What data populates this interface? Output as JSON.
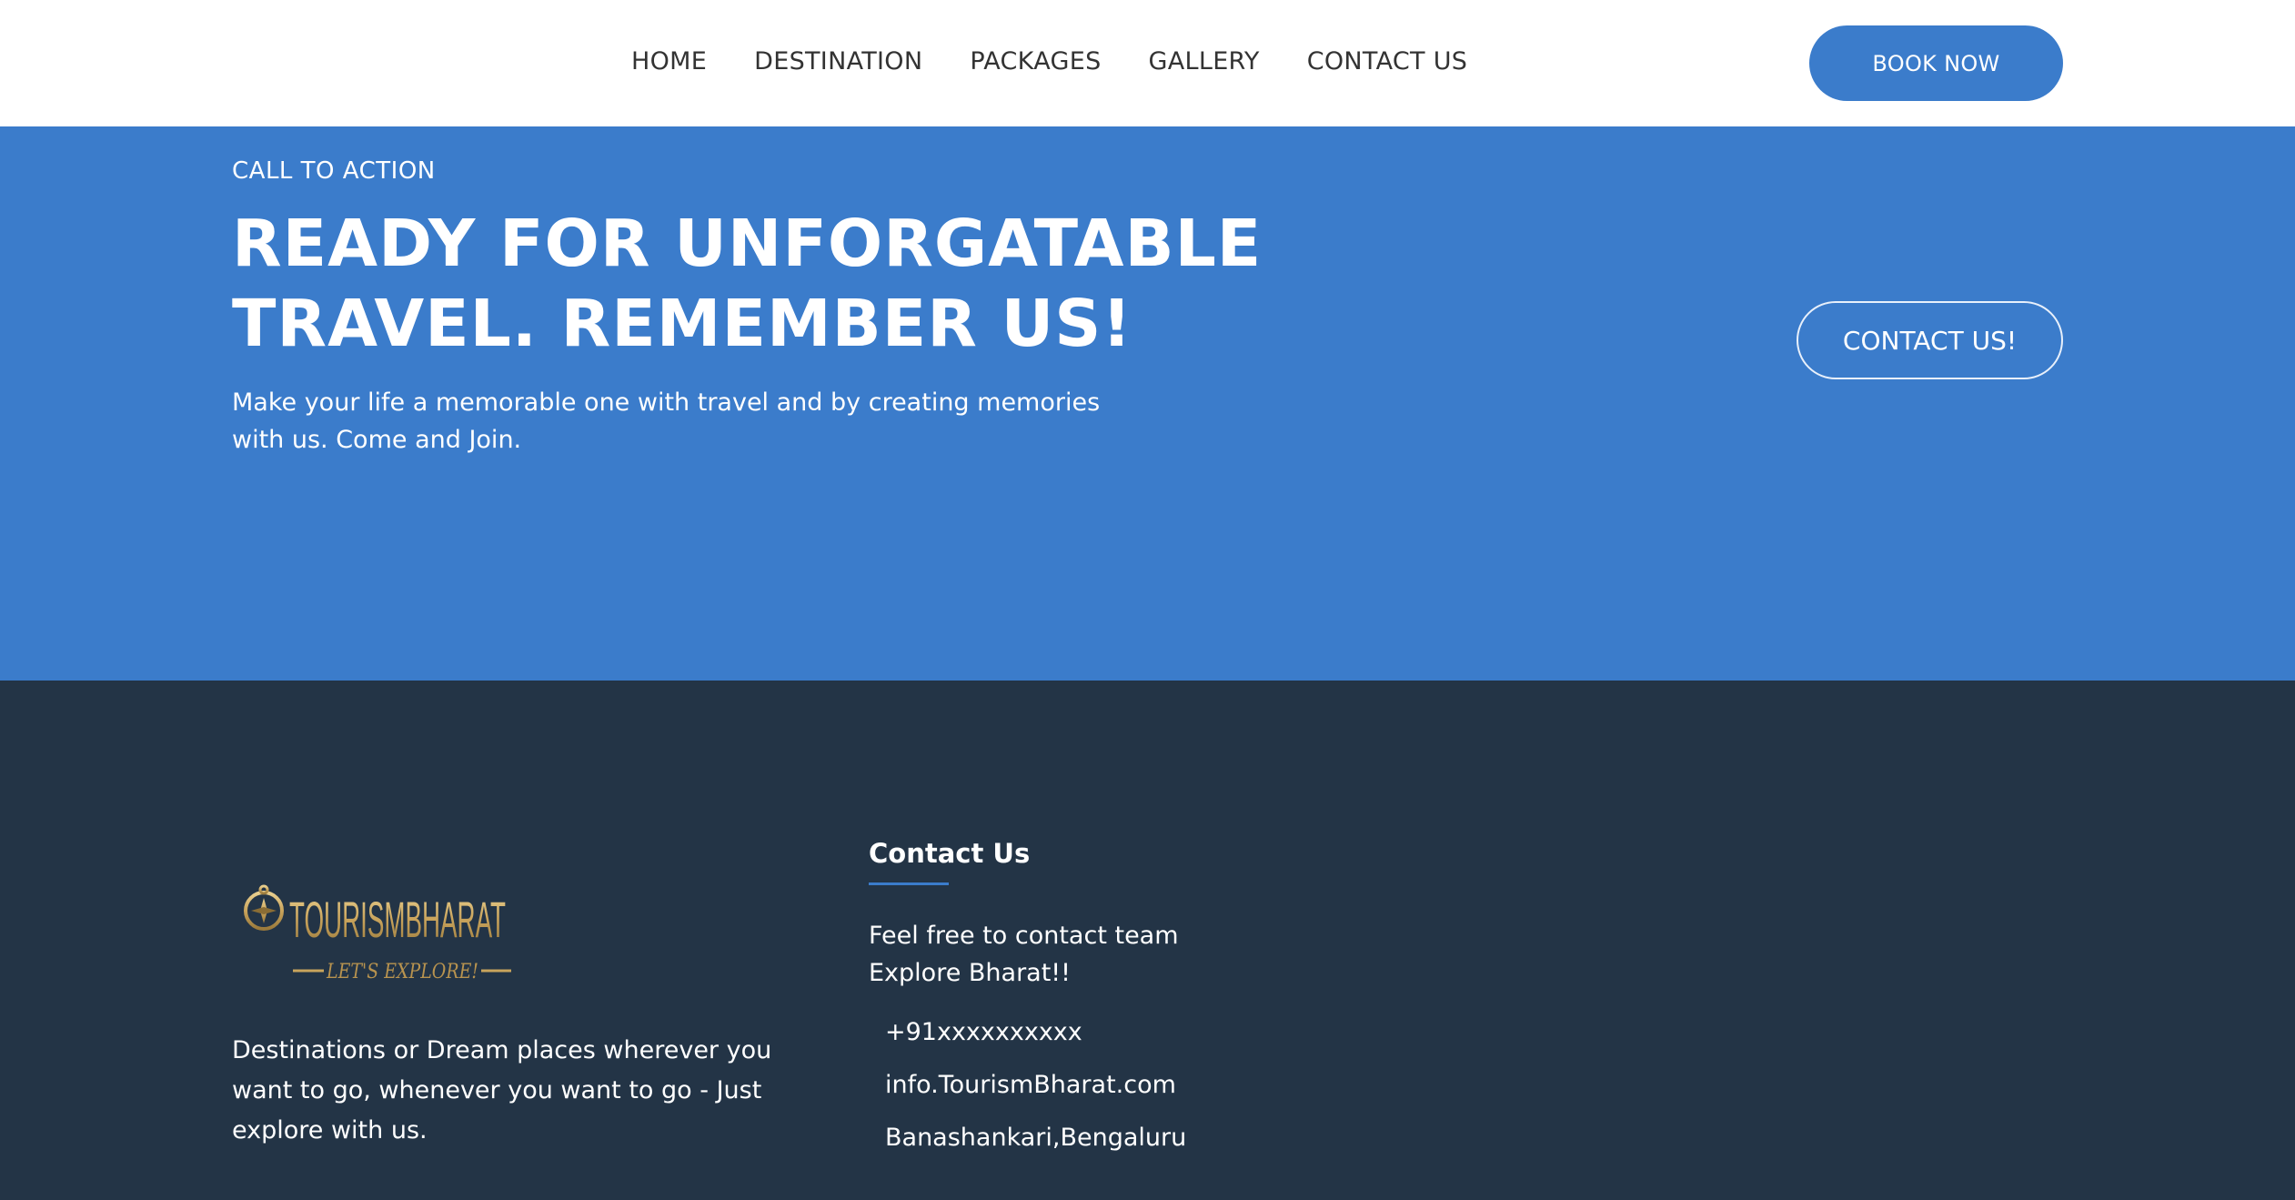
{
  "header": {
    "nav": [
      "HOME",
      "DESTINATION",
      "PACKAGES",
      "GALLERY",
      "CONTACT US"
    ],
    "book_button": "BOOK NOW"
  },
  "cta": {
    "kicker": "CALL TO ACTION",
    "title_line1": "READY FOR UNFORGATABLE",
    "title_line2": "TRAVEL. REMEMBER US!",
    "text": "Make your life a memorable one with travel and by creating memories with us. Come and Join.",
    "contact_button": "CONTACT US!"
  },
  "footer": {
    "logo_text": "TOURISMBHARAT",
    "logo_tagline": "LET'S EXPLORE!",
    "about": "Destinations or Dream places wherever you want to go, whenever you want to go - Just explore with us.",
    "contact_heading": "Contact Us",
    "contact_intro": "Feel free to contact team Explore Bharat!!",
    "phone": "+91xxxxxxxxxx",
    "email": "info.TourismBharat.com",
    "address": "Banashankari,Bengaluru"
  },
  "colors": {
    "accent": "#3b7ccb",
    "footer_bg": "#233446",
    "logo_gold": "#c9a45c"
  }
}
